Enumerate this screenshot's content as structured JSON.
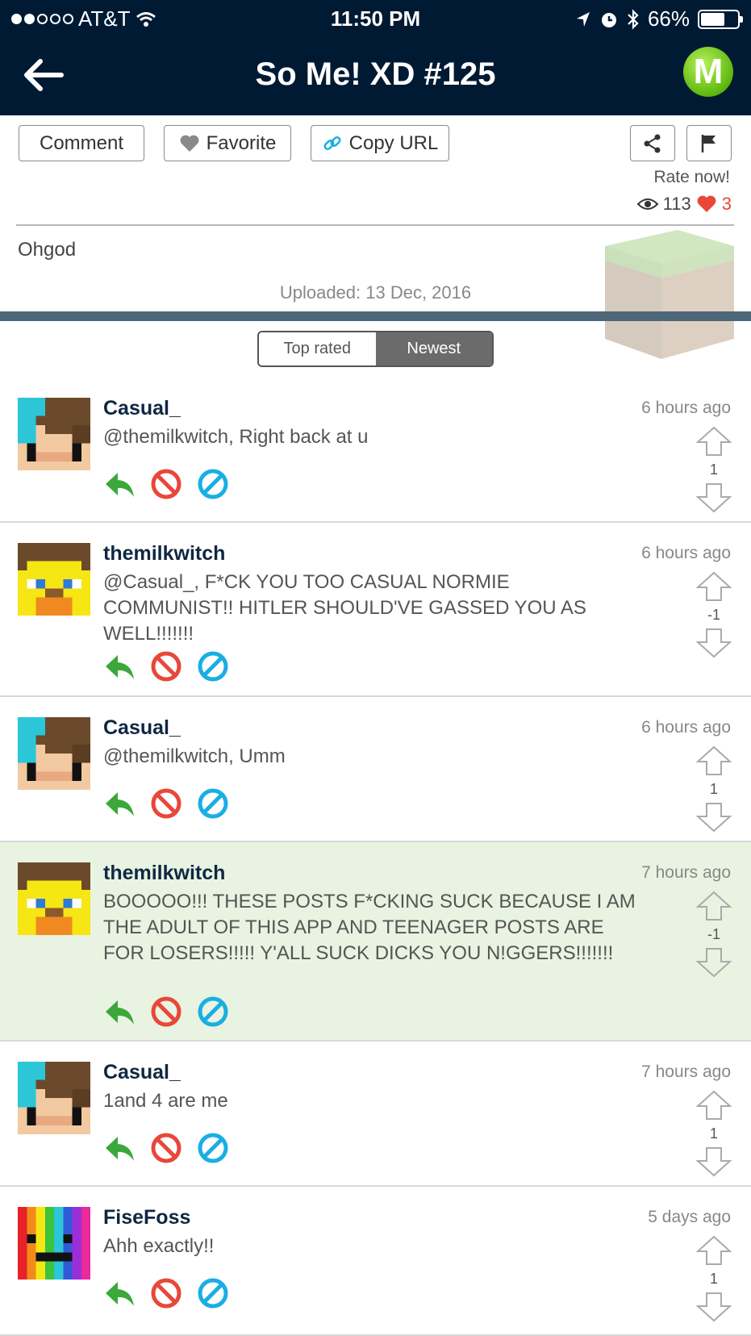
{
  "status": {
    "carrier": "AT&T",
    "time": "11:50 PM",
    "battery": "66%"
  },
  "nav": {
    "title": "So Me! XD #125",
    "logo_letter": "M"
  },
  "actions": {
    "comment_label": "Comment",
    "favorite_label": "Favorite",
    "copy_url_label": "Copy URL"
  },
  "post": {
    "rate_label": "Rate now!",
    "views": "113",
    "likes": "3",
    "text": "Ohgod",
    "uploaded": "Uploaded: 13 Dec, 2016"
  },
  "sort": {
    "top_rated": "Top rated",
    "newest": "Newest",
    "selected": "Newest"
  },
  "comments": [
    {
      "user": "Casual_",
      "time": "6 hours ago",
      "text": "@themilkwitch, Right back at u",
      "score": "1",
      "avatar": "cyan-skin-avatar"
    },
    {
      "user": "themilkwitch",
      "time": "6 hours ago",
      "text": "@Casual_, F*CK YOU TOO CASUAL NORMIE COMMUNIST!! HITLER SHOULD'VE GASSED YOU AS WELL!!!!!!!",
      "score": "-1",
      "avatar": "yellow-skin-avatar"
    },
    {
      "user": "Casual_",
      "time": "6 hours ago",
      "text": "@themilkwitch, Umm",
      "score": "1",
      "avatar": "cyan-skin-avatar"
    },
    {
      "user": "themilkwitch",
      "time": "7 hours ago",
      "text": "BOOOOO!!! THESE POSTS F*CKING SUCK BECAUSE I AM THE ADULT OF THIS APP AND TEENAGER POSTS ARE FOR LOSERS!!!!! Y'ALL SUCK DICKS YOU N!GGERS!!!!!!!",
      "score": "-1",
      "avatar": "yellow-skin-avatar"
    },
    {
      "user": "Casual_",
      "time": "7 hours ago",
      "text": "1and 4 are me",
      "score": "1",
      "avatar": "cyan-skin-avatar"
    },
    {
      "user": "FiseFoss",
      "time": "5 days ago",
      "text": "Ahh exactly!!",
      "score": "1",
      "avatar": "rainbow-skin-avatar"
    }
  ],
  "colors": {
    "header_bg": "#001a33",
    "reply_green": "#3aa83a",
    "block_red": "#e8473a",
    "ban_cyan": "#1aaee5",
    "highlight_row": "#e9f3e1"
  }
}
